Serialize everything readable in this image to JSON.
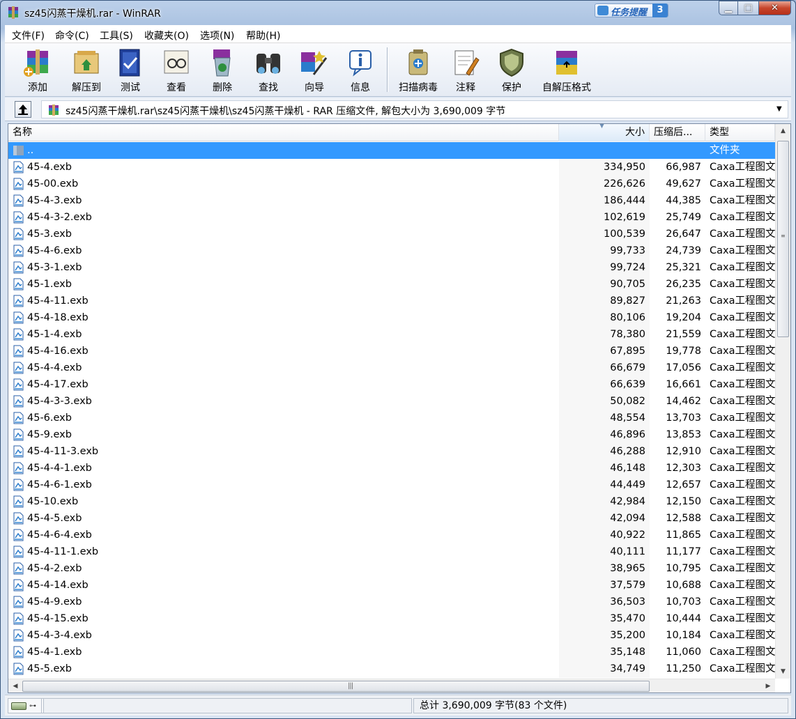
{
  "window": {
    "title": "sz45闪蒸干燥机.rar - WinRAR",
    "task_badge_label": "任务提醒",
    "task_badge_count": "3",
    "min_glyph": "▁",
    "max_glyph": "□",
    "close_glyph": "✕"
  },
  "menu": [
    "文件(F)",
    "命令(C)",
    "工具(S)",
    "收藏夹(O)",
    "选项(N)",
    "帮助(H)"
  ],
  "toolbar": [
    {
      "label": "添加",
      "icon": "add-archive-icon"
    },
    {
      "label": "解压到",
      "icon": "extract-to-icon"
    },
    {
      "label": "测试",
      "icon": "test-icon"
    },
    {
      "label": "查看",
      "icon": "view-icon"
    },
    {
      "label": "删除",
      "icon": "delete-icon"
    },
    {
      "label": "查找",
      "icon": "find-icon"
    },
    {
      "label": "向导",
      "icon": "wizard-icon"
    },
    {
      "label": "信息",
      "icon": "info-icon"
    },
    {
      "label": "扫描病毒",
      "icon": "virus-scan-icon"
    },
    {
      "label": "注释",
      "icon": "comment-icon"
    },
    {
      "label": "保护",
      "icon": "protect-icon"
    },
    {
      "label": "自解压格式",
      "icon": "sfx-icon"
    }
  ],
  "address": {
    "path": "sz45闪蒸干燥机.rar\\sz45闪蒸干燥机\\sz45闪蒸干燥机 - RAR 压缩文件, 解包大小为 3,690,009 字节"
  },
  "columns": {
    "name": "名称",
    "size": "大小",
    "packed": "压缩后...",
    "type": "类型"
  },
  "parent_row": {
    "name": "..",
    "type": "文件夹"
  },
  "files": [
    {
      "name": "45-4.exb",
      "size": "334,950",
      "packed": "66,987",
      "type": "Caxa工程图文"
    },
    {
      "name": "45-00.exb",
      "size": "226,626",
      "packed": "49,627",
      "type": "Caxa工程图文"
    },
    {
      "name": "45-4-3.exb",
      "size": "186,444",
      "packed": "44,385",
      "type": "Caxa工程图文"
    },
    {
      "name": "45-4-3-2.exb",
      "size": "102,619",
      "packed": "25,749",
      "type": "Caxa工程图文"
    },
    {
      "name": "45-3.exb",
      "size": "100,539",
      "packed": "26,647",
      "type": "Caxa工程图文"
    },
    {
      "name": "45-4-6.exb",
      "size": "99,733",
      "packed": "24,739",
      "type": "Caxa工程图文"
    },
    {
      "name": "45-3-1.exb",
      "size": "99,724",
      "packed": "25,321",
      "type": "Caxa工程图文"
    },
    {
      "name": "45-1.exb",
      "size": "90,705",
      "packed": "26,235",
      "type": "Caxa工程图文"
    },
    {
      "name": "45-4-11.exb",
      "size": "89,827",
      "packed": "21,263",
      "type": "Caxa工程图文"
    },
    {
      "name": "45-4-18.exb",
      "size": "80,106",
      "packed": "19,204",
      "type": "Caxa工程图文"
    },
    {
      "name": "45-1-4.exb",
      "size": "78,380",
      "packed": "21,559",
      "type": "Caxa工程图文"
    },
    {
      "name": "45-4-16.exb",
      "size": "67,895",
      "packed": "19,778",
      "type": "Caxa工程图文"
    },
    {
      "name": "45-4-4.exb",
      "size": "66,679",
      "packed": "17,056",
      "type": "Caxa工程图文"
    },
    {
      "name": "45-4-17.exb",
      "size": "66,639",
      "packed": "16,661",
      "type": "Caxa工程图文"
    },
    {
      "name": "45-4-3-3.exb",
      "size": "50,082",
      "packed": "14,462",
      "type": "Caxa工程图文"
    },
    {
      "name": "45-6.exb",
      "size": "48,554",
      "packed": "13,703",
      "type": "Caxa工程图文"
    },
    {
      "name": "45-9.exb",
      "size": "46,896",
      "packed": "13,853",
      "type": "Caxa工程图文"
    },
    {
      "name": "45-4-11-3.exb",
      "size": "46,288",
      "packed": "12,910",
      "type": "Caxa工程图文"
    },
    {
      "name": "45-4-4-1.exb",
      "size": "46,148",
      "packed": "12,303",
      "type": "Caxa工程图文"
    },
    {
      "name": "45-4-6-1.exb",
      "size": "44,449",
      "packed": "12,657",
      "type": "Caxa工程图文"
    },
    {
      "name": "45-10.exb",
      "size": "42,984",
      "packed": "12,150",
      "type": "Caxa工程图文"
    },
    {
      "name": "45-4-5.exb",
      "size": "42,094",
      "packed": "12,588",
      "type": "Caxa工程图文"
    },
    {
      "name": "45-4-6-4.exb",
      "size": "40,922",
      "packed": "11,865",
      "type": "Caxa工程图文"
    },
    {
      "name": "45-4-11-1.exb",
      "size": "40,111",
      "packed": "11,177",
      "type": "Caxa工程图文"
    },
    {
      "name": "45-4-2.exb",
      "size": "38,965",
      "packed": "10,795",
      "type": "Caxa工程图文"
    },
    {
      "name": "45-4-14.exb",
      "size": "37,579",
      "packed": "10,688",
      "type": "Caxa工程图文"
    },
    {
      "name": "45-4-9.exb",
      "size": "36,503",
      "packed": "10,703",
      "type": "Caxa工程图文"
    },
    {
      "name": "45-4-15.exb",
      "size": "35,470",
      "packed": "10,444",
      "type": "Caxa工程图文"
    },
    {
      "name": "45-4-3-4.exb",
      "size": "35,200",
      "packed": "10,184",
      "type": "Caxa工程图文"
    },
    {
      "name": "45-4-1.exb",
      "size": "35,148",
      "packed": "11,060",
      "type": "Caxa工程图文"
    },
    {
      "name": "45-5.exb",
      "size": "34,749",
      "packed": "11,250",
      "type": "Caxa工程图文"
    }
  ],
  "status": {
    "summary": "总计 3,690,009 字节(83 个文件)"
  },
  "colors": {
    "selection": "#3399ff",
    "close_button": "#c7462c"
  }
}
